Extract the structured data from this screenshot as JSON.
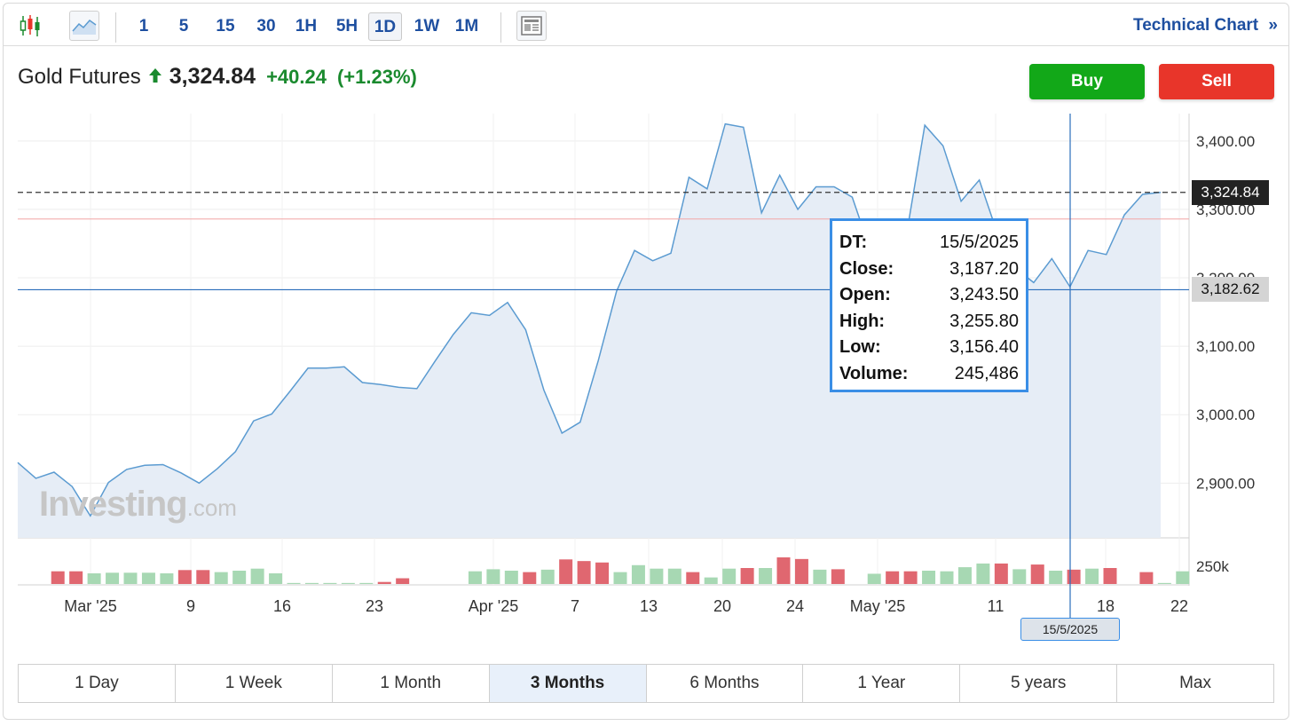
{
  "toolbar": {
    "timeframes": [
      "1",
      "5",
      "15",
      "30",
      "1H",
      "5H",
      "1D",
      "1W",
      "1M"
    ],
    "active_timeframe": "1D",
    "technical_chart_label": "Technical Chart",
    "technical_chart_chevron": "»"
  },
  "header": {
    "instrument": "Gold Futures",
    "price": "3,324.84",
    "change": "+40.24",
    "change_pct": "(+1.23%)",
    "trend_icon": "arrow-up-icon",
    "buy_label": "Buy",
    "sell_label": "Sell"
  },
  "colors": {
    "up": "#12a818",
    "down": "#e8352a",
    "line": "#5b9bd1",
    "area": "#e6edf6",
    "vol_up": "#a7d8b3",
    "vol_down": "#e06770",
    "link": "#1e4fa0"
  },
  "chart_data": {
    "type": "area",
    "y_ticks": [
      "3,400.00",
      "3,300.00",
      "3,200.00",
      "3,100.00",
      "3,000.00",
      "2,900.00"
    ],
    "ylim": [
      2820,
      3440
    ],
    "x_ticks": [
      "Mar '25",
      "9",
      "16",
      "23",
      "Apr '25",
      "7",
      "13",
      "20",
      "24",
      "May '25",
      "11",
      "18",
      "22"
    ],
    "series": [
      {
        "values": [
          2930,
          2907,
          2916,
          2895,
          2852,
          2901,
          2920,
          2926,
          2927,
          2915,
          2900,
          2921,
          2946,
          2991,
          3001,
          3034,
          3068,
          3068,
          3070,
          3047,
          3044,
          3040,
          3038,
          3078,
          3117,
          3149,
          3145,
          3164,
          3124,
          3036,
          2973,
          2989,
          3079,
          3180,
          3240,
          3225,
          3236,
          3347,
          3330,
          3425,
          3420,
          3295,
          3350,
          3300,
          3333,
          3333,
          3318,
          3240,
          3213,
          3265,
          3423,
          3393,
          3312,
          3343,
          3265,
          3214,
          3193,
          3228,
          3187,
          3240,
          3234,
          3292,
          3322,
          3325
        ]
      }
    ],
    "volume": [
      {
        "v": 0.62,
        "up": false
      },
      {
        "v": 0.62,
        "up": false
      },
      {
        "v": 0.52,
        "up": true
      },
      {
        "v": 0.55,
        "up": true
      },
      {
        "v": 0.55,
        "up": true
      },
      {
        "v": 0.55,
        "up": true
      },
      {
        "v": 0.52,
        "up": true
      },
      {
        "v": 0.68,
        "up": false
      },
      {
        "v": 0.68,
        "up": false
      },
      {
        "v": 0.58,
        "up": true
      },
      {
        "v": 0.65,
        "up": true
      },
      {
        "v": 0.75,
        "up": true
      },
      {
        "v": 0.52,
        "up": true
      },
      {
        "v": 0.05,
        "up": true
      },
      {
        "v": 0.05,
        "up": true
      },
      {
        "v": 0.05,
        "up": true
      },
      {
        "v": 0.05,
        "up": true
      },
      {
        "v": 0.05,
        "up": true
      },
      {
        "v": 0.1,
        "up": false
      },
      {
        "v": 0.28,
        "up": false
      },
      {
        "v": 0,
        "up": true
      },
      {
        "v": 0,
        "up": true
      },
      {
        "v": 0,
        "up": true
      },
      {
        "v": 0.62,
        "up": true
      },
      {
        "v": 0.72,
        "up": true
      },
      {
        "v": 0.65,
        "up": true
      },
      {
        "v": 0.58,
        "up": false
      },
      {
        "v": 0.7,
        "up": true
      },
      {
        "v": 1.2,
        "up": false
      },
      {
        "v": 1.12,
        "up": false
      },
      {
        "v": 1.05,
        "up": false
      },
      {
        "v": 0.58,
        "up": true
      },
      {
        "v": 0.92,
        "up": true
      },
      {
        "v": 0.75,
        "up": true
      },
      {
        "v": 0.75,
        "up": true
      },
      {
        "v": 0.58,
        "up": false
      },
      {
        "v": 0.32,
        "up": true
      },
      {
        "v": 0.75,
        "up": true
      },
      {
        "v": 0.78,
        "up": false
      },
      {
        "v": 0.78,
        "up": true
      },
      {
        "v": 1.3,
        "up": false
      },
      {
        "v": 1.22,
        "up": false
      },
      {
        "v": 0.7,
        "up": true
      },
      {
        "v": 0.72,
        "up": false
      },
      {
        "v": 0,
        "up": true
      },
      {
        "v": 0.5,
        "up": true
      },
      {
        "v": 0.62,
        "up": false
      },
      {
        "v": 0.62,
        "up": false
      },
      {
        "v": 0.65,
        "up": true
      },
      {
        "v": 0.62,
        "up": true
      },
      {
        "v": 0.82,
        "up": true
      },
      {
        "v": 1.0,
        "up": true
      },
      {
        "v": 1.0,
        "up": false
      },
      {
        "v": 0.72,
        "up": true
      },
      {
        "v": 0.95,
        "up": false
      },
      {
        "v": 0.65,
        "up": true
      },
      {
        "v": 0.7,
        "up": false
      },
      {
        "v": 0.75,
        "up": true
      },
      {
        "v": 0.78,
        "up": false
      },
      {
        "v": 0,
        "up": true
      },
      {
        "v": 0.58,
        "up": false
      },
      {
        "v": 0.05,
        "up": true
      },
      {
        "v": 0.62,
        "up": true
      },
      {
        "v": 0,
        "up": true
      }
    ],
    "volume_label": "250k",
    "current_price_label": "3,324.84",
    "current_price": 3324.84,
    "crosshair_price_label": "3,182.62",
    "crosshair_price": 3182.62,
    "red_line_price": 3286,
    "crosshair_index": 58,
    "crosshair_date": "15/5/2025"
  },
  "tooltip": {
    "dt_label": "DT:",
    "dt": "15/5/2025",
    "close_label": "Close:",
    "close": "3,187.20",
    "open_label": "Open:",
    "open": "3,243.50",
    "high_label": "High:",
    "high": "3,255.80",
    "low_label": "Low:",
    "low": "3,156.40",
    "volume_label": "Volume:",
    "volume": "245,486"
  },
  "watermark": {
    "brand": "Investing",
    "suffix": ".com"
  },
  "ranges": [
    "1 Day",
    "1 Week",
    "1 Month",
    "3 Months",
    "6 Months",
    "1 Year",
    "5 years",
    "Max"
  ],
  "active_range": "3 Months"
}
